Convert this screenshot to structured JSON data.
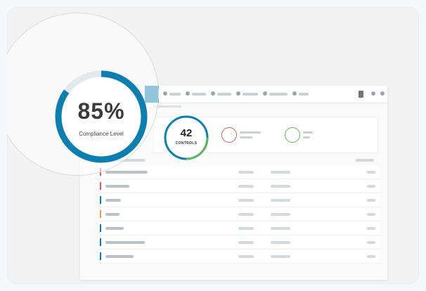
{
  "compliance": {
    "value": "85%",
    "label": "Compliance Level",
    "fraction": 0.85,
    "ring_color": "#0b7fb1"
  },
  "controls": {
    "value": "42",
    "label": "CONTROLS",
    "ring_color": "#0b7fb1",
    "accent_color": "#5cb85c"
  },
  "stats": [
    {
      "icon": "clock-icon",
      "color": "#e05a5a"
    },
    {
      "icon": "check-icon",
      "color": "#5cb85c"
    }
  ],
  "rows": [
    {
      "accent": "#e05a5a"
    },
    {
      "accent": "#e05a5a"
    },
    {
      "accent": "#0b7fb1"
    },
    {
      "accent": "#f0a030"
    },
    {
      "accent": "#0b7fb1"
    },
    {
      "accent": "#0b7fb1"
    },
    {
      "accent": "#0b7fb1"
    }
  ]
}
